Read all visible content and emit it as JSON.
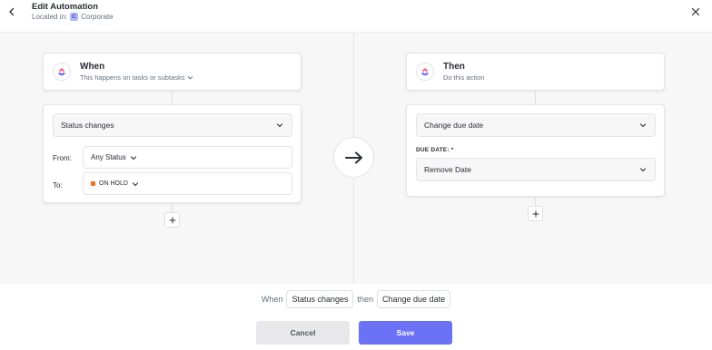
{
  "header": {
    "title": "Edit Automation",
    "location_prefix": "Located in:",
    "location_badge": "C",
    "location_name": "Corporate"
  },
  "trigger": {
    "title": "When",
    "subtitle": "This happens on tasks or subtasks",
    "select_value": "Status changes",
    "from_label": "From:",
    "from_value": "Any Status",
    "to_label": "To:",
    "to_value": "ON HOLD",
    "to_color": "#f2711c"
  },
  "action": {
    "title": "Then",
    "subtitle": "Do this action",
    "select_value": "Change due date",
    "due_label": "DUE DATE: *",
    "due_value": "Remove Date"
  },
  "summary": {
    "when": "When",
    "trigger_chip": "Status changes",
    "then": "then",
    "action_chip": "Change due date"
  },
  "footer": {
    "cancel_label": "Cancel",
    "save_label": "Save"
  },
  "colors": {
    "accent": "#6b72f5",
    "status_on_hold": "#f2711c"
  }
}
